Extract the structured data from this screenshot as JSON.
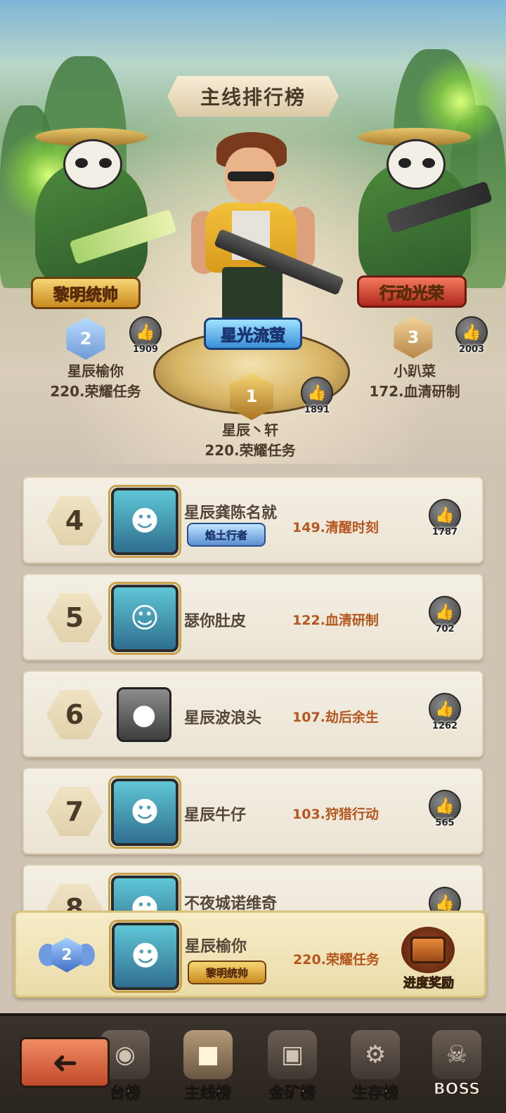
{
  "header": {
    "title": "主线排行榜"
  },
  "podium": [
    {
      "rank": "2",
      "name": "星辰榆你",
      "progress": "220.荣耀任务",
      "likes": "1909",
      "title_badge": "黎明统帅"
    },
    {
      "rank": "1",
      "name": "星辰丶轩",
      "progress": "220.荣耀任务",
      "likes": "1891",
      "title_badge": "星光流萤"
    },
    {
      "rank": "3",
      "name": "小趴菜",
      "progress": "172.血清研制",
      "likes": "2003",
      "title_badge": "行动光荣"
    }
  ],
  "list": [
    {
      "rank": "4",
      "name": "星辰龚陈名就",
      "tag": "焰土行者",
      "progress": "149.清醒时刻",
      "likes": "1787"
    },
    {
      "rank": "5",
      "name": "瑟你肚皮",
      "tag": "",
      "progress": "122.血清研制",
      "likes": "702"
    },
    {
      "rank": "6",
      "name": "星辰波浪头",
      "tag": "",
      "progress": "107.劫后余生",
      "likes": "1262"
    },
    {
      "rank": "7",
      "name": "星辰牛仔",
      "tag": "",
      "progress": "103.狩猎行动",
      "likes": "565"
    },
    {
      "rank": "8",
      "name": "不夜城诺维奇",
      "tag": "",
      "progress": "",
      "likes": ""
    }
  ],
  "my_rank": {
    "rank": "2",
    "name": "星辰榆你",
    "tag": "黎明统帅",
    "progress": "220.荣耀任务",
    "reward_label": "进度奖励"
  },
  "nav": {
    "items": [
      {
        "label": "台榜"
      },
      {
        "label": "主线榜"
      },
      {
        "label": "金矿榜"
      },
      {
        "label": "生存榜"
      },
      {
        "label": "BOSS"
      }
    ],
    "active_index": 1
  },
  "colors": {
    "accent": "#b4561e",
    "nav_bg": "#2a241f",
    "row_bg": "#f4efe4",
    "my_bar_bg": "#f6ecc8"
  },
  "icons": {
    "like": "thumbs-up-icon",
    "back": "arrow-left-icon",
    "reward": "treasure-chest-icon"
  }
}
